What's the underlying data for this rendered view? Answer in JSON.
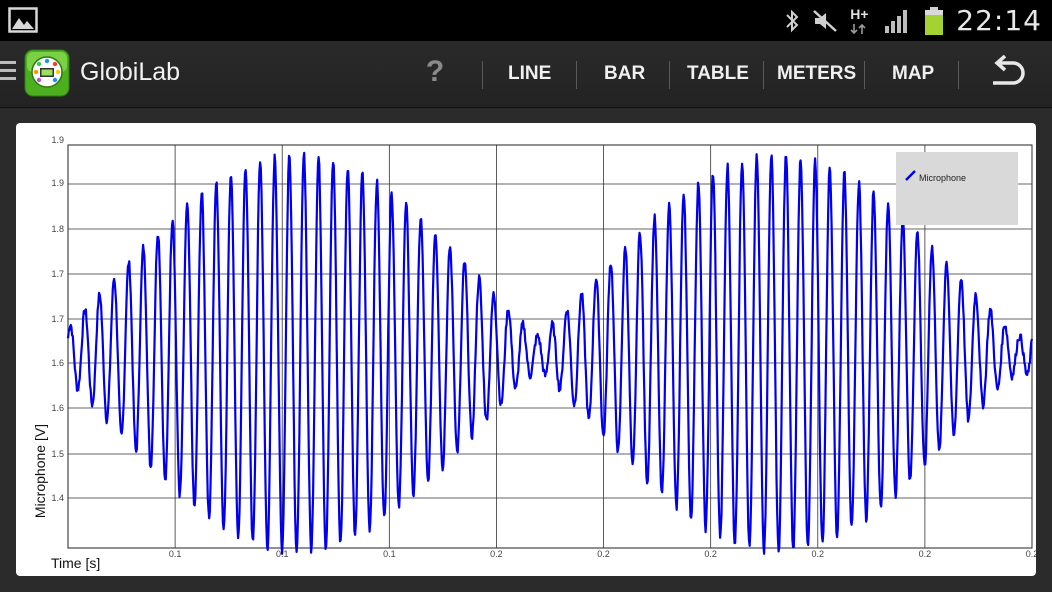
{
  "status_bar": {
    "time": "22:14",
    "network_type": "H+",
    "icons": [
      "gallery-icon",
      "bluetooth-icon",
      "mute-icon",
      "signal-icon",
      "battery-icon"
    ]
  },
  "app": {
    "title": "GlobiLab",
    "help_label": "?",
    "tabs": [
      {
        "label": "LINE"
      },
      {
        "label": "BAR"
      },
      {
        "label": "TABLE"
      },
      {
        "label": "METERS"
      },
      {
        "label": "MAP"
      }
    ]
  },
  "colors": {
    "series": "#0000ee",
    "legend_bg": "#d9d9d9",
    "accent_green": "#4caf1f",
    "battery": "#a4d233"
  },
  "chart_data": {
    "type": "line",
    "title": "",
    "xlabel": "Time [s]",
    "ylabel": "Microphone [V]",
    "x_ticks": [
      "0.1",
      "0.1",
      "0.1",
      "0.2",
      "0.2",
      "0.2",
      "0.2",
      "0.2",
      "0.2",
      "0.2"
    ],
    "y_ticks": [
      "1.4",
      "1.5",
      "1.6",
      "1.6",
      "1.7",
      "1.7",
      "1.8",
      "1.9"
    ],
    "y_top_tick": "1.9",
    "ylim": [
      1.35,
      1.95
    ],
    "grid": true,
    "legend": {
      "position": "top-right",
      "entries": [
        "Microphone"
      ]
    },
    "series": [
      {
        "name": "Microphone",
        "x_range": [
          0.0,
          0.22
        ],
        "carrier_cycles": 66,
        "beat_cycles": 2,
        "center": 1.64,
        "max_amplitude": 0.27,
        "description": "amplitude-modulated oscillation with two beat envelopes"
      }
    ]
  }
}
